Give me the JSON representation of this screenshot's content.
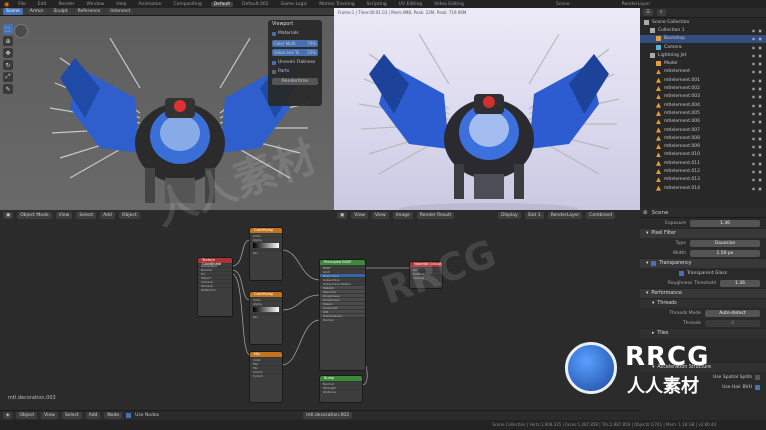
{
  "topbar": {
    "menus": [
      "File",
      "Edit",
      "Render",
      "Window",
      "Help"
    ],
    "workspaces": [
      "Layout",
      "Modeling",
      "Sculpting",
      "UV Editing",
      "Texture Paint",
      "Shading",
      "Animation",
      "Rendering",
      "Compositing",
      "Default",
      "Default.002",
      "Game Logic",
      "Motion Tracking",
      "Scripting",
      "UV Editing",
      "Video Editing"
    ],
    "active_workspace": "Default",
    "scene": "Scene",
    "render_layer": "RenderLayer"
  },
  "viewport": {
    "tabs": [
      "Scene",
      "Armor",
      "Sculpt",
      "Reference",
      "Intersect"
    ],
    "mode": "Object Mode",
    "menus": [
      "View",
      "Select",
      "Add",
      "Object"
    ]
  },
  "overlay_panel": {
    "title": "Viewport",
    "items": [
      {
        "label": "Materials"
      },
      {
        "label": "Color Multi",
        "value": "70%"
      },
      {
        "label": "Value and Te",
        "value": "25%"
      },
      {
        "label": "Uneven Flatness"
      },
      {
        "label": "Parts"
      }
    ],
    "button": "Rendertime"
  },
  "render_view": {
    "info": "Frame:1 | Time:00:01.03 | Mem:4MB, Peak: 22M, Peak: 719.96M",
    "menus": [
      "View",
      "View",
      "Image"
    ],
    "result_label": "Render Result",
    "display_label": "Display",
    "slot_label": "Slot 1",
    "layer_label": "RenderLayer",
    "combined_label": "Combined"
  },
  "outliner": {
    "scene_collection": "Scene Collection",
    "items": [
      {
        "name": "Collection 1",
        "depth": 1,
        "type": "collection"
      },
      {
        "name": "Backdrop",
        "depth": 2,
        "type": "object",
        "selected": true
      },
      {
        "name": "Camera",
        "depth": 2,
        "type": "camera"
      },
      {
        "name": "Lightning Jet",
        "depth": 1,
        "type": "collection"
      },
      {
        "name": "Model",
        "depth": 2,
        "type": "object"
      },
      {
        "name": "mtlelement",
        "depth": 2,
        "type": "mesh"
      },
      {
        "name": "mtlelement.001",
        "depth": 2,
        "type": "mesh"
      },
      {
        "name": "mtlelement.002",
        "depth": 2,
        "type": "mesh"
      },
      {
        "name": "mtlelement.003",
        "depth": 2,
        "type": "mesh"
      },
      {
        "name": "mtlelement.004",
        "depth": 2,
        "type": "mesh"
      },
      {
        "name": "mtlelement.005",
        "depth": 2,
        "type": "mesh"
      },
      {
        "name": "mtlelement.006",
        "depth": 2,
        "type": "mesh"
      },
      {
        "name": "mtlelement.007",
        "depth": 2,
        "type": "mesh"
      },
      {
        "name": "mtlelement.008",
        "depth": 2,
        "type": "mesh"
      },
      {
        "name": "mtlelement.009",
        "depth": 2,
        "type": "mesh"
      },
      {
        "name": "mtlelement.010",
        "depth": 2,
        "type": "mesh"
      },
      {
        "name": "mtlelement.011",
        "depth": 2,
        "type": "mesh"
      },
      {
        "name": "mtlelement.012",
        "depth": 2,
        "type": "mesh"
      },
      {
        "name": "mtlelement.013",
        "depth": 2,
        "type": "mesh"
      },
      {
        "name": "mtlelement.014",
        "depth": 2,
        "type": "mesh"
      }
    ]
  },
  "properties": {
    "header": "Scene",
    "exposure_label": "Exposure",
    "exposure_value": "1.36",
    "pixel_filter": "Pixel Filter",
    "type_label": "Type",
    "type_value": "Gaussian",
    "width_label": "Width",
    "width_value": "1.50 px",
    "transparency": "Transparency",
    "transparent_glass": "Transparent Glass",
    "roughness_label": "Roughness Threshold",
    "roughness_value": "1.36",
    "performance": "Performance",
    "threads": "Threads",
    "threads_mode_label": "Threads Mode",
    "threads_mode_value": "Auto-detect",
    "threads_label": "Threads",
    "threads_value": "4",
    "tiles": "Tiles",
    "acceleration": "Acceleration Structure",
    "spatial_splits": "Use Spatial Splits",
    "hair_bvh": "Use Hair BVH"
  },
  "node_editor": {
    "material_name": "mtl.decoration.003",
    "bottom_label": "mtl.decoration.003",
    "object_menu": "Object",
    "menus": [
      "View",
      "Select",
      "Add",
      "Node"
    ],
    "use_nodes": "Use Nodes",
    "nodes": {
      "texture_coord": "Texture Coordinate",
      "color_ramp1": "ColorRamp",
      "color_ramp2": "ColorRamp",
      "mix1": "Mix",
      "principled": "Principled BSDF",
      "output": "Material Output",
      "bump": "Bump"
    }
  },
  "statusbar": {
    "text": "Scene Collection | Verts:1,908,335 | Faces:1,487,858 | Tris:2,987,859 | Objects:1/741 | Mem: 1.18 GB | v2.80.44"
  },
  "watermarks": [
    "RRCG",
    "人人素材",
    "RRCG",
    "人人素材"
  ]
}
